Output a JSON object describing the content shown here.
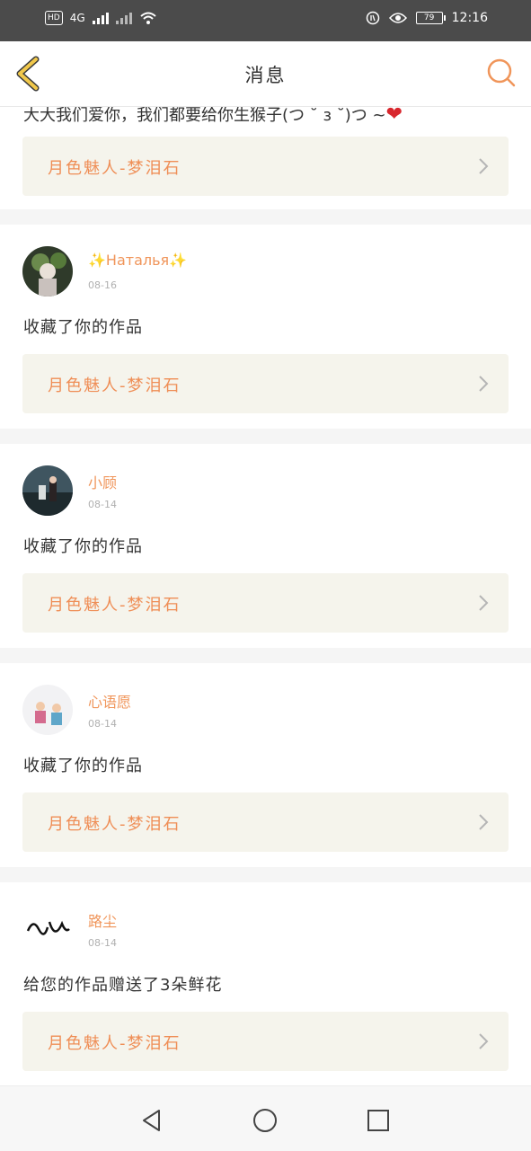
{
  "status_bar": {
    "left_badge": "HD",
    "network": "4G",
    "battery": "79",
    "time": "12:16"
  },
  "header": {
    "title": "消息"
  },
  "partial_item": {
    "text": "大大我们爱你，我们都要给你生猴子(つ ˘ з ˘)つ ~"
  },
  "messages": [
    {
      "username": "✨Наталья✨",
      "date": "08-16",
      "text": "收藏了你的作品",
      "work_title": "月色魅人-梦泪石"
    },
    {
      "username": "小顾",
      "date": "08-14",
      "text": "收藏了你的作品",
      "work_title": "月色魅人-梦泪石"
    },
    {
      "username": "心语愿",
      "date": "08-14",
      "text": "收藏了你的作品",
      "work_title": "月色魅人-梦泪石"
    },
    {
      "username": "路尘",
      "date": "08-14",
      "text": "给您的作品赠送了3朵鲜花",
      "work_title": "月色魅人-梦泪石"
    }
  ],
  "partial_work_title": "月色魅人-梦泪石",
  "colors": {
    "accent": "#f0955a",
    "back_arrow": "#e8b83a",
    "work_bg": "#f5f4ec"
  }
}
